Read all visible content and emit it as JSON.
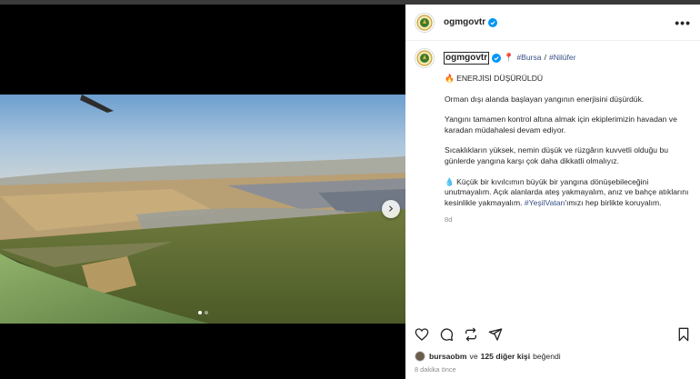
{
  "post": {
    "username": "ogmgovtr",
    "location_tags": [
      "#Bursa",
      "#Nilüfer"
    ],
    "location_sep": "/",
    "caption_title": "ENERJİSİ DÜŞÜRÜLDÜ",
    "paragraphs": [
      "Orman dışı alanda başlayan yangının enerjisini düşürdük.",
      "Yangını tamamen kontrol altına almak için ekiplerimizin havadan ve karadan müdahalesi devam ediyor.",
      "Sıcaklıkların yüksek, nemin düşük ve rüzgârın kuvvetli olduğu bu günlerde yangına karşı çok daha dikkatli olmalıyız."
    ],
    "final_paragraph_start": "Küçük bir kıvılcımın büyük bir yangına dönüşebileceğini unutmayalım. Açık alanlarda ateş yakmayalım, anız ve bahçe atıklarını kesinlikle yakmayalım.",
    "final_hashtag": "#YeşilVatan",
    "final_paragraph_end": "'ımızı hep birlikte koruyalım.",
    "age": "8d",
    "liker": "bursaobm",
    "likes_joiner": "ve",
    "likes_others": "125 diğer kişi",
    "likes_suffix": "beğendi",
    "posted_ago": "8 dakika önce",
    "more_glyph": "•••",
    "next_glyph": "›"
  },
  "icons": {
    "header": [
      "verified-badge-icon",
      "more-options-icon"
    ],
    "caption": [
      "fire-emoji-icon",
      "pin-emoji-icon",
      "leaf-emoji-icon"
    ],
    "actions": [
      "heart-icon",
      "comment-icon",
      "repost-icon",
      "share-icon",
      "bookmark-icon"
    ]
  },
  "carousel": {
    "slides": 2,
    "active_slide": 1
  },
  "colors": {
    "hashtag": "#385185",
    "verified": "#0095f6",
    "muted": "#8e8e8e"
  }
}
